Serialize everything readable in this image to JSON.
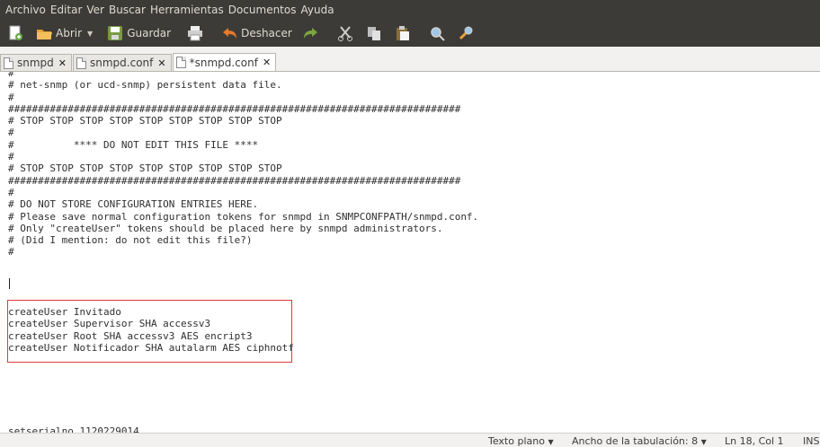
{
  "menubar": {
    "items": [
      "Archivo",
      "Editar",
      "Ver",
      "Buscar",
      "Herramientas",
      "Documentos",
      "Ayuda"
    ]
  },
  "toolbar": {
    "new_icon": "new-document-icon",
    "open_label": "Abrir",
    "save_label": "Guardar",
    "print_icon": "print-icon",
    "undo_label": "Deshacer",
    "redo_icon": "redo-icon",
    "cut_icon": "cut-icon",
    "copy_icon": "copy-icon",
    "paste_icon": "paste-icon",
    "search_icon": "search-icon",
    "replace_icon": "replace-icon"
  },
  "tabs": [
    {
      "label": "snmpd",
      "active": false
    },
    {
      "label": "snmpd.conf",
      "active": false
    },
    {
      "label": "*snmpd.conf",
      "active": true
    }
  ],
  "editor": {
    "lines": [
      "#",
      "# net-snmp (or ucd-snmp) persistent data file.",
      "#",
      "############################################################################",
      "# STOP STOP STOP STOP STOP STOP STOP STOP STOP",
      "#",
      "#          **** DO NOT EDIT THIS FILE ****",
      "#",
      "# STOP STOP STOP STOP STOP STOP STOP STOP STOP",
      "############################################################################",
      "#",
      "# DO NOT STORE CONFIGURATION ENTRIES HERE.",
      "# Please save normal configuration tokens for snmpd in SNMPCONFPATH/snmpd.conf.",
      "# Only \"createUser\" tokens should be placed here by snmpd administrators.",
      "# (Did I mention: do not edit this file?)",
      "#",
      "",
      "",
      "",
      "",
      "createUser Invitado",
      "createUser Supervisor SHA accessv3",
      "createUser Root SHA accessv3 AES encript3",
      "createUser Notificador SHA autalarm AES ciphnotf",
      "",
      "",
      "",
      "",
      "",
      "",
      "setserialno 1120229014",
      "##################################################################",
      "#"
    ]
  },
  "statusbar": {
    "syntax": "Texto plano",
    "tab_width": "Ancho de la tabulación: 8",
    "position": "Ln 18, Col 1",
    "mode": "INS"
  }
}
